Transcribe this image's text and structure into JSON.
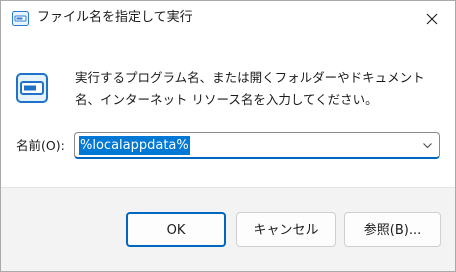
{
  "window": {
    "title": "ファイル名を指定して実行"
  },
  "message": {
    "text": "実行するプログラム名、または開くフォルダーやドキュメント名、インターネット リソース名を入力してください。"
  },
  "open": {
    "label": "名前(O):",
    "value": "%localappdata%"
  },
  "buttons": {
    "ok": "OK",
    "cancel": "キャンセル",
    "browse": "参照(B)..."
  },
  "colors": {
    "accent": "#0067c0",
    "selection": "#0078d4",
    "footer_bg": "#f3f3f3"
  },
  "icons": {
    "title": "run-dialog-icon",
    "close": "close-icon",
    "run": "run-program-icon",
    "dropdown": "chevron-down-icon"
  }
}
